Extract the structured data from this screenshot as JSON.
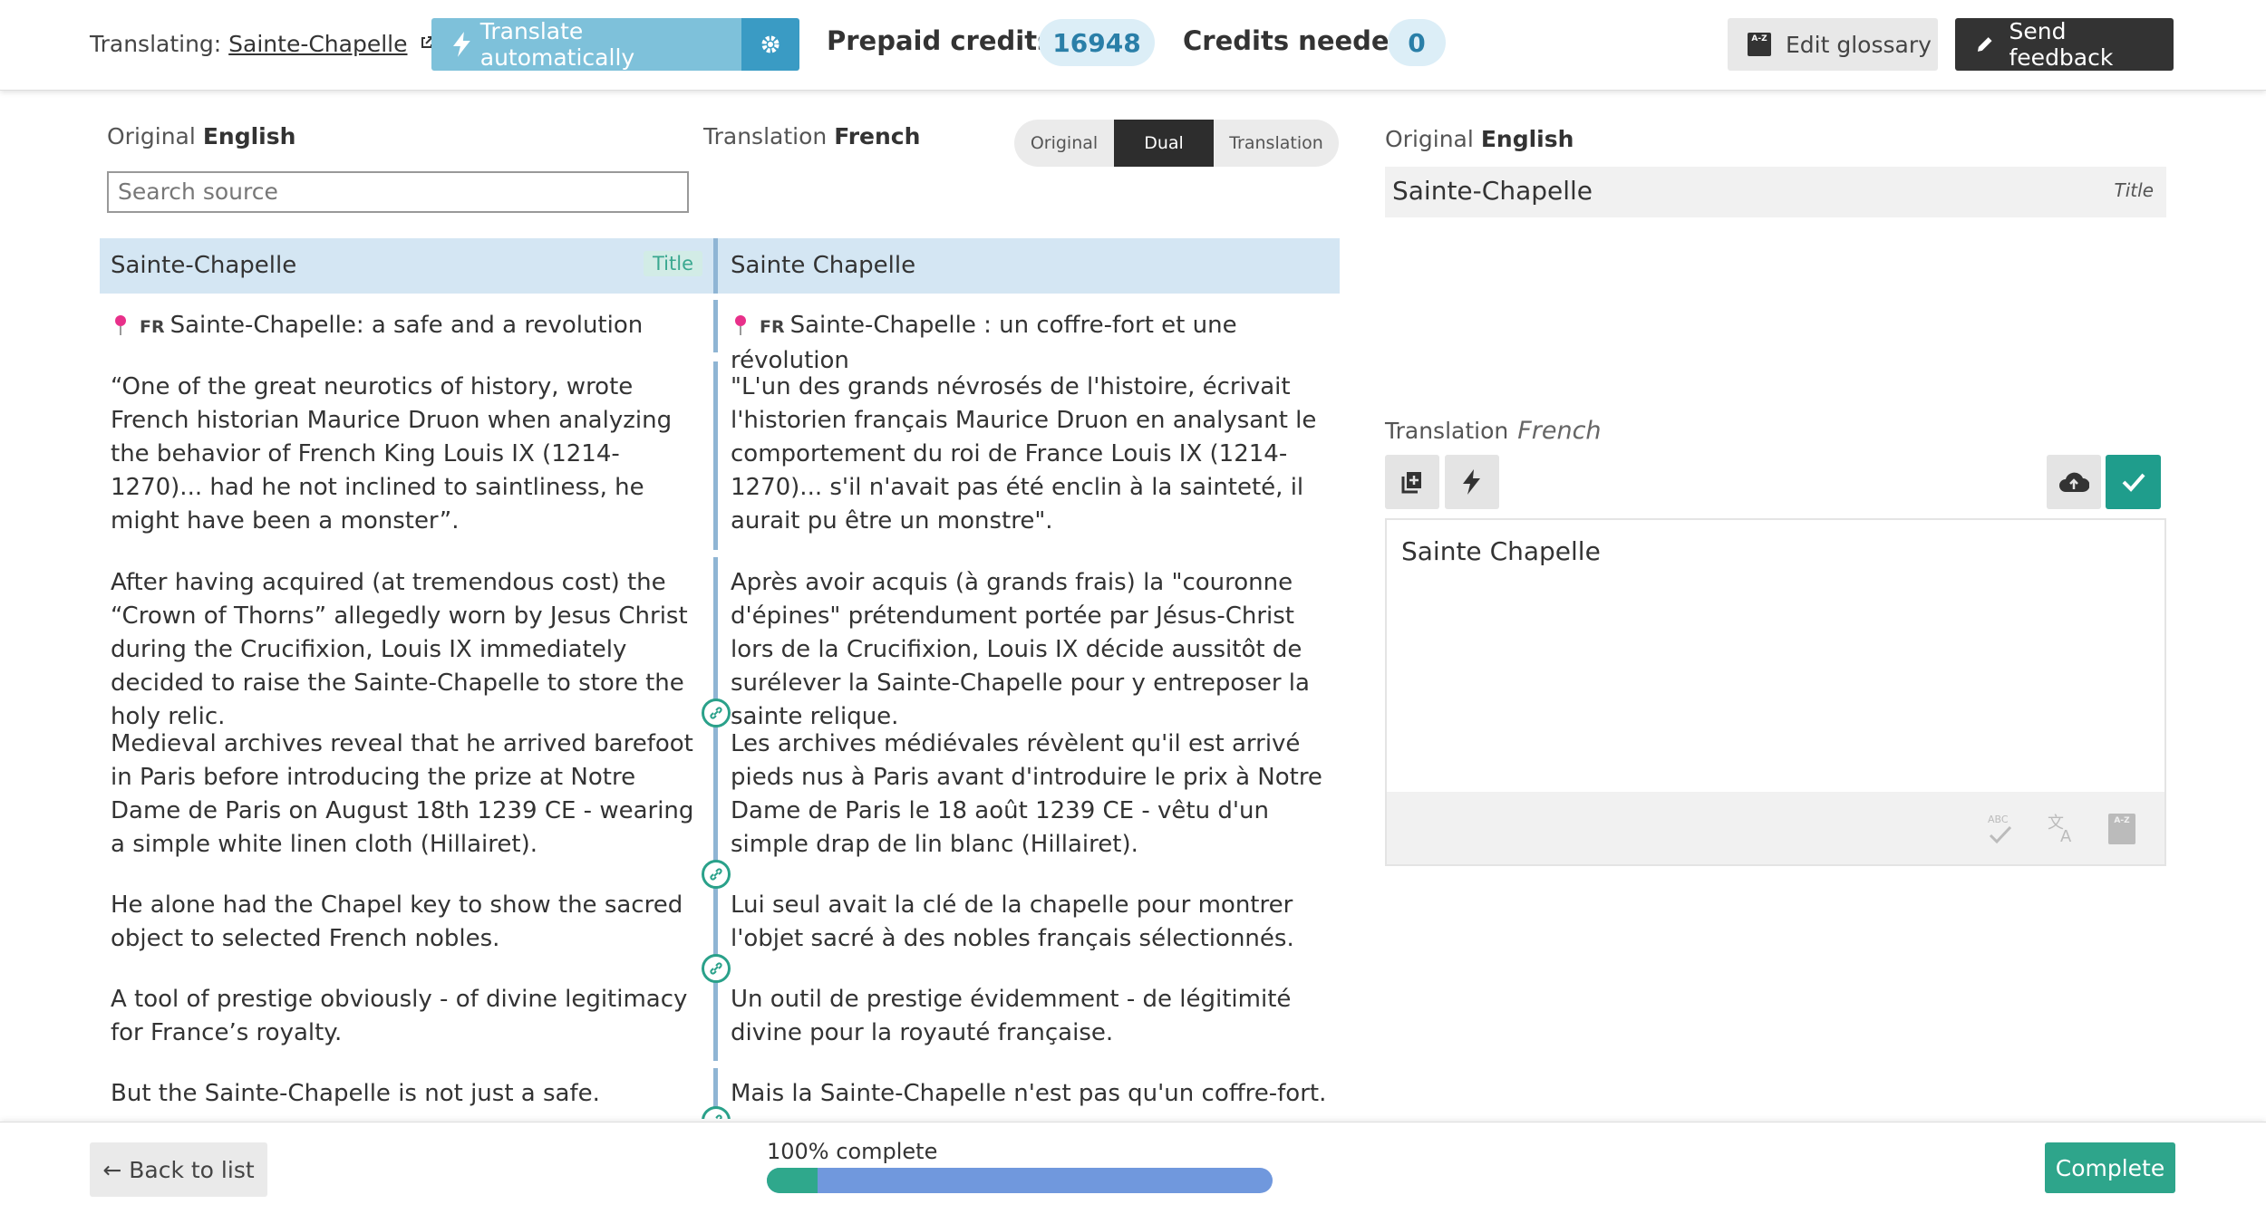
{
  "header": {
    "translating_label": "Translating:",
    "document_title": "Sainte-Chapelle",
    "translate_auto_label": "Translate automatically",
    "prepaid_label": "Prepaid credits:",
    "prepaid_value": "16948",
    "credits_needed_label": "Credits needed",
    "credits_needed_value": "0",
    "edit_glossary_label": "Edit glossary",
    "send_feedback_label": "Send feedback"
  },
  "columns": {
    "original_label": "Original",
    "original_lang": "English",
    "translation_label": "Translation",
    "translation_lang": "French",
    "search_placeholder": "Search source",
    "view_modes": [
      "Original",
      "Dual",
      "Translation"
    ],
    "active_view": "Dual"
  },
  "segments": [
    {
      "source": "Sainte-Chapelle",
      "target": "Sainte Chapelle",
      "badge": "Title"
    },
    {
      "lang_tag": "FR",
      "source": "Sainte-Chapelle: a safe and a revolution",
      "target": "Sainte-Chapelle : un coffre-fort et une révolution"
    },
    {
      "source": "“One of the great neurotics of history, wrote French historian Maurice Druon when analyzing the behavior of French King Louis IX (1214-1270)... had he not inclined to saintliness, he might have been a monster”.",
      "target": "\"L'un des grands névrosés de l'histoire, écrivait l'historien français Maurice Druon en analysant le comportement du roi de France Louis IX (1214-1270)... s'il n'avait pas été enclin à la sainteté, il aurait pu être un monstre\"."
    },
    {
      "source": "After having acquired (at tremendous cost) the “Crown of Thorns” allegedly worn by Jesus Christ during the Crucifixion, Louis IX immediately decided to raise the Sainte-Chapelle to store the holy relic.",
      "target": "Après avoir acquis (à grands frais) la \"couronne d'épines\" prétendument portée par Jésus-Christ lors de la Crucifixion, Louis IX décide aussitôt de surélever la Sainte-Chapelle pour y entreposer la sainte relique."
    },
    {
      "source": "Medieval archives reveal that he arrived barefoot in Paris before introducing the prize at Notre Dame de Paris on August 18th 1239 CE - wearing a simple white linen cloth (Hillairet).",
      "target": "Les archives médiévales révèlent qu'il est arrivé pieds nus à Paris avant d'introduire le prix à Notre Dame de Paris le 18 août 1239 CE - vêtu d'un simple drap de lin blanc (Hillairet)."
    },
    {
      "source": "He alone had the Chapel key to show the sacred object to selected French nobles.",
      "target": "Lui seul avait la clé de la chapelle pour montrer l'objet sacré à des nobles français sélectionnés."
    },
    {
      "source": "A tool of prestige obviously - of divine legitimacy for France’s royalty.",
      "target": "Un outil de prestige évidemment - de légitimité divine pour la royauté française."
    },
    {
      "source": "But the Sainte-Chapelle is not just a safe.",
      "target": "Mais la Sainte-Chapelle n'est pas qu'un coffre-fort."
    }
  ],
  "panel": {
    "original_label": "Original",
    "original_lang": "English",
    "original_text": "Sainte-Chapelle",
    "original_tag": "Title",
    "translation_label": "Translation",
    "translation_lang": "French",
    "translation_text": "Sainte Chapelle"
  },
  "footer": {
    "back_label": "← Back to list",
    "progress_label": "100% complete",
    "progress_percent": 100,
    "complete_label": "Complete"
  },
  "colors": {
    "accent_teal": "#2ea58b",
    "accent_blue": "#3a9bc4",
    "selected_row": "#d4e6f3",
    "progress_blue": "#7098dd"
  }
}
